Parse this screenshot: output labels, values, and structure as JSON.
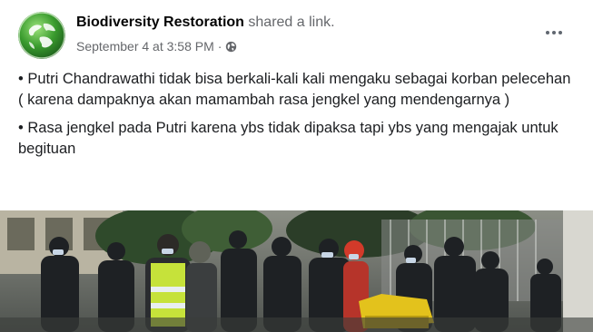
{
  "post": {
    "page_name": "Biodiversity Restoration",
    "action_text": "shared a link.",
    "timestamp": "September 4 at 3:58 PM",
    "separator": "·",
    "privacy_icon": "globe-icon",
    "more_icon": "more-horizontal-icon",
    "paragraphs": [
      "• Putri Chandrawathi tidak bisa  berkali-kali kali mengaku sebagai korban  pelecehan ( karena dampaknya akan mamambah rasa jengkel yang mendengarnya )",
      "• Rasa jengkel pada Putri karena ybs tidak dipaksa tapi ybs yang mengajak untuk  begituan"
    ]
  },
  "colors": {
    "name": "#050505",
    "secondary": "#65676b",
    "avatar_green": "#2e8b2f"
  }
}
